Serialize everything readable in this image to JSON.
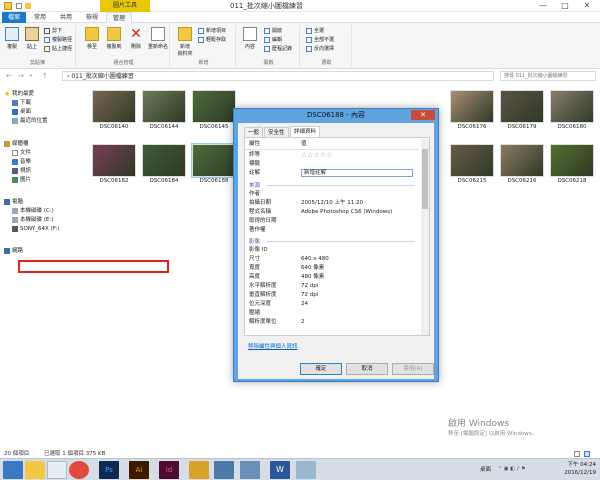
{
  "window": {
    "context_tab": "圖片工具",
    "title": "011_批次縮小圖檔練習",
    "controls": {
      "minimize": "—",
      "maximize": "□",
      "close": "✕"
    }
  },
  "ribbon_tabs": [
    "檔案",
    "常用",
    "共用",
    "檢視",
    "管理"
  ],
  "ribbon": {
    "clipboard": {
      "name": "剪貼簿",
      "copy": "複製",
      "paste": "貼上",
      "cut": "剪下",
      "copy_path": "複製路徑",
      "paste_shortcut": "貼上捷徑"
    },
    "organize": {
      "name": "組合管理",
      "move_to": "移至",
      "copy_to": "複製到",
      "delete": "刪除",
      "rename": "重新命名"
    },
    "new": {
      "name": "新增",
      "new_folder": "新增\n資料夾",
      "new_item": "新增項目",
      "easy_access": "輕鬆存取"
    },
    "open": {
      "name": "開啟",
      "properties": "內容",
      "open": "開啟",
      "edit": "編輯",
      "history": "歷程記錄"
    },
    "select": {
      "name": "選取",
      "select_all": "全選",
      "select_none": "全部不選",
      "invert": "反向選擇"
    }
  },
  "address": {
    "path": "011_批次縮小圖檔練習",
    "search_placeholder": "搜尋 011_批次縮小圖檔練習"
  },
  "nav": {
    "favorites": "我的最愛",
    "downloads": "下載",
    "desktop": "桌面",
    "recent": "最近的位置",
    "libraries": "媒體櫃",
    "documents": "文件",
    "music": "音樂",
    "videos": "視訊",
    "pictures": "圖片",
    "computer": "電腦",
    "drive_c": "本機磁碟 (C:)",
    "drive_e": "本機磁碟 (E:)",
    "drive_f": "SONY_64X (F:)",
    "network": "網路"
  },
  "files": [
    {
      "name": "DSC06140",
      "color": "#7a6552"
    },
    {
      "name": "DSC06144",
      "color": "#6d7a5a"
    },
    {
      "name": "DSC06145",
      "color": "#4e6a3a"
    },
    {
      "name": "DSC06176",
      "color": "#a88f72"
    },
    {
      "name": "DSC06179",
      "color": "#5d5247"
    },
    {
      "name": "DSC06180",
      "color": "#8a7d6d"
    },
    {
      "name": "DSC06182",
      "color": "#7a3d5a"
    },
    {
      "name": "DSC06184",
      "color": "#3f5b34"
    },
    {
      "name": "DSC06188",
      "color": "#4f6e3c"
    },
    {
      "name": "DSC06215",
      "color": "#6b5a4a"
    },
    {
      "name": "DSC06216",
      "color": "#8d7a63"
    },
    {
      "name": "DSC06218",
      "color": "#556e2f"
    }
  ],
  "dialog": {
    "title": "DSC06188 - 內容",
    "close": "✕",
    "tabs": [
      "一般",
      "安全性",
      "詳細資料"
    ],
    "header": {
      "property": "屬性",
      "value": "值"
    },
    "rows_top": [
      {
        "label": "評等",
        "value": "☆☆☆☆☆"
      },
      {
        "label": "標籤",
        "value": ""
      },
      {
        "label": "註解",
        "value": "新增註解"
      }
    ],
    "section_origin": "來源",
    "rows_origin": [
      {
        "label": "作者",
        "value": ""
      },
      {
        "label": "拍攝日期",
        "value": "2005/12/10 上午 11:20"
      },
      {
        "label": "程式名稱",
        "value": "Adobe Photoshop CS6 (Windows)"
      },
      {
        "label": "取得的日期",
        "value": ""
      },
      {
        "label": "著作權",
        "value": ""
      }
    ],
    "section_image": "影像",
    "rows_image": [
      {
        "label": "影像 ID",
        "value": ""
      },
      {
        "label": "尺寸",
        "value": "640 x 480"
      },
      {
        "label": "寬度",
        "value": "640 像素"
      },
      {
        "label": "高度",
        "value": "480 像素"
      },
      {
        "label": "水平解析度",
        "value": "72 dpi"
      },
      {
        "label": "垂直解析度",
        "value": "72 dpi"
      },
      {
        "label": "位元深度",
        "value": "24"
      },
      {
        "label": "壓縮",
        "value": ""
      },
      {
        "label": "解析度單位",
        "value": "2"
      }
    ],
    "link": "移除屬性與個人資訊",
    "buttons": {
      "ok": "確定",
      "cancel": "取消",
      "apply": "套用(A)"
    }
  },
  "watermark": {
    "line1": "啟用 Windows",
    "line2": "移至 [電腦設定] 以啟用 Windows。"
  },
  "status": {
    "count": "20 個項目",
    "selected": "已選取 1 個項目 375 KB"
  },
  "tray": {
    "desktop": "桌面",
    "time": "下午 04:24",
    "date": "2016/12/19"
  },
  "taskbar_apps": [
    {
      "name": "file-explorer",
      "color": "#f2c744"
    },
    {
      "name": "chrome",
      "color": "#e04a3a"
    },
    {
      "name": "photoshop",
      "color": "#0e2a53"
    },
    {
      "name": "illustrator",
      "color": "#3b1b00"
    },
    {
      "name": "indesign",
      "color": "#4b0c2d"
    },
    {
      "name": "folder",
      "color": "#d9a22a"
    },
    {
      "name": "screen",
      "color": "#4d7aa6"
    },
    {
      "name": "photo",
      "color": "#6a8fb4"
    },
    {
      "name": "word",
      "color": "#2b579a"
    },
    {
      "name": "app",
      "color": "#9bb6d1"
    }
  ]
}
